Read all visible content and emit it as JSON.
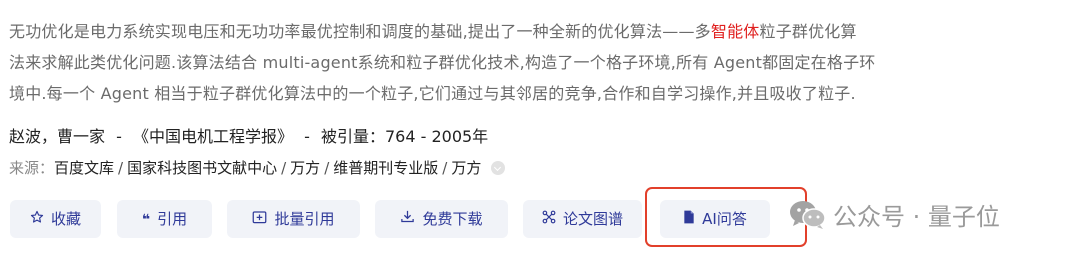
{
  "abstract": {
    "line1_pre": "无功优化是电力系统实现电压和无功功率最优控制和调度的基础,提出了一种全新的优化算法——多",
    "line1_hl": "智能体",
    "line1_post": "粒子群优化算",
    "line2": "法来求解此类优化问题.该算法结合 multi-agent系统和粒子群优化技术,构造了一个格子环境,所有 Agent都固定在格子环",
    "line3": "境中.每一个 Agent 相当于粒子群优化算法中的一个粒子,它们通过与其邻居的竞争,合作和自学习操作,并且吸收了粒子."
  },
  "meta": {
    "authors": "赵波，曹一家",
    "sep": "-",
    "journal": "《中国电机工程学报》",
    "citations": "被引量：764 - 2005年"
  },
  "source": {
    "label": "来源：",
    "items": [
      "百度文库",
      "国家科技图书文献中心",
      "万方",
      "维普期刊专业版",
      "万方"
    ]
  },
  "toolbar": {
    "favorite": "收藏",
    "cite": "引用",
    "batch_cite": "批量引用",
    "download": "免费下载",
    "graph": "论文图谱",
    "ai_qa": "AI问答"
  },
  "watermark": {
    "text": "公众号 · 量子位"
  },
  "colors": {
    "accent": "#2f3a99",
    "highlight": "#e0201f",
    "box": "#e2402b",
    "button_bg": "#f1f3f8"
  },
  "icons": {
    "favorite": "star-icon",
    "cite": "quote-icon",
    "batch_cite": "plus-box-icon",
    "download": "download-icon",
    "graph": "graph-icon",
    "ai_qa": "document-icon"
  }
}
